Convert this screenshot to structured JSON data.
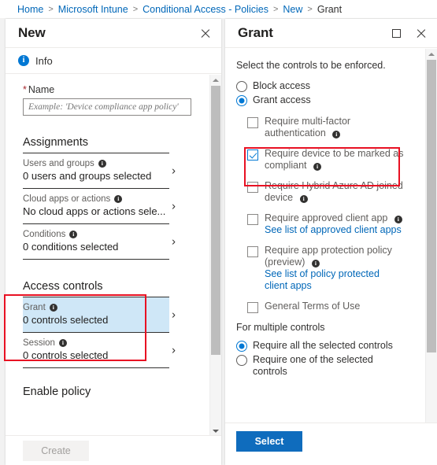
{
  "breadcrumb": {
    "items": [
      {
        "label": "Home",
        "current": false
      },
      {
        "label": "Microsoft Intune",
        "current": false
      },
      {
        "label": "Conditional Access - Policies",
        "current": false
      },
      {
        "label": "New",
        "current": false
      },
      {
        "label": "Grant",
        "current": true
      }
    ],
    "separator": ">"
  },
  "colors": {
    "accent": "#0078d4",
    "link": "#0067b8",
    "primary_button": "#0f6cbd",
    "annotation": "#e81123",
    "row_highlight": "#cfe7f7",
    "required_star": "#a4262c"
  },
  "left_panel": {
    "title": "New",
    "close_icon": "close-icon",
    "info_bar": {
      "icon": "info-icon",
      "glyph": "i",
      "label": "Info"
    },
    "name_field": {
      "label": "Name",
      "required_marker": "*",
      "value": "",
      "placeholder": "Example: 'Device compliance app policy'"
    },
    "assignments": {
      "heading": "Assignments",
      "rows": [
        {
          "title": "Users and groups",
          "value": "0 users and groups selected",
          "info": true,
          "chevron": "›"
        },
        {
          "title": "Cloud apps or actions",
          "value": "No cloud apps or actions sele...",
          "info": true,
          "chevron": "›"
        },
        {
          "title": "Conditions",
          "value": "0 conditions selected",
          "info": true,
          "chevron": "›"
        }
      ]
    },
    "access_controls": {
      "heading": "Access controls",
      "rows": [
        {
          "title": "Grant",
          "value": "0 controls selected",
          "info": true,
          "chevron": "›",
          "selected": true
        },
        {
          "title": "Session",
          "value": "0 controls selected",
          "info": true,
          "chevron": "›",
          "selected": false
        }
      ]
    },
    "enable_policy": {
      "heading": "Enable policy"
    },
    "create_button": {
      "label": "Create",
      "enabled": false
    },
    "scrollbar": {
      "up_arrow": "scroll-up",
      "down_arrow": "scroll-down"
    }
  },
  "right_panel": {
    "title": "Grant",
    "maximize_icon": "maximize-icon",
    "close_icon": "close-icon",
    "intro": "Select the controls to be enforced.",
    "access_radios": [
      {
        "label": "Block access",
        "selected": false
      },
      {
        "label": "Grant access",
        "selected": true
      }
    ],
    "controls": [
      {
        "label": "Require multi-factor authentication",
        "checked": false,
        "info": true,
        "link": null
      },
      {
        "label": "Require device to be marked as compliant",
        "checked": true,
        "info": true,
        "link": null
      },
      {
        "label": "Require Hybrid Azure AD joined device",
        "checked": false,
        "info": true,
        "link": null
      },
      {
        "label": "Require approved client app",
        "checked": false,
        "info": true,
        "link": "See list of approved client apps"
      },
      {
        "label": "Require app protection policy (preview)",
        "checked": false,
        "info": true,
        "link": "See list of policy protected client apps"
      },
      {
        "label": "General Terms of Use",
        "checked": false,
        "info": false,
        "link": null
      }
    ],
    "multiple_controls": {
      "heading": "For multiple controls",
      "options": [
        {
          "label": "Require all the selected controls",
          "selected": true
        },
        {
          "label": "Require one of the selected controls",
          "selected": false
        }
      ]
    },
    "select_button": {
      "label": "Select"
    },
    "scrollbar": {
      "up_arrow": "scroll-up",
      "down_arrow": "scroll-down"
    }
  }
}
